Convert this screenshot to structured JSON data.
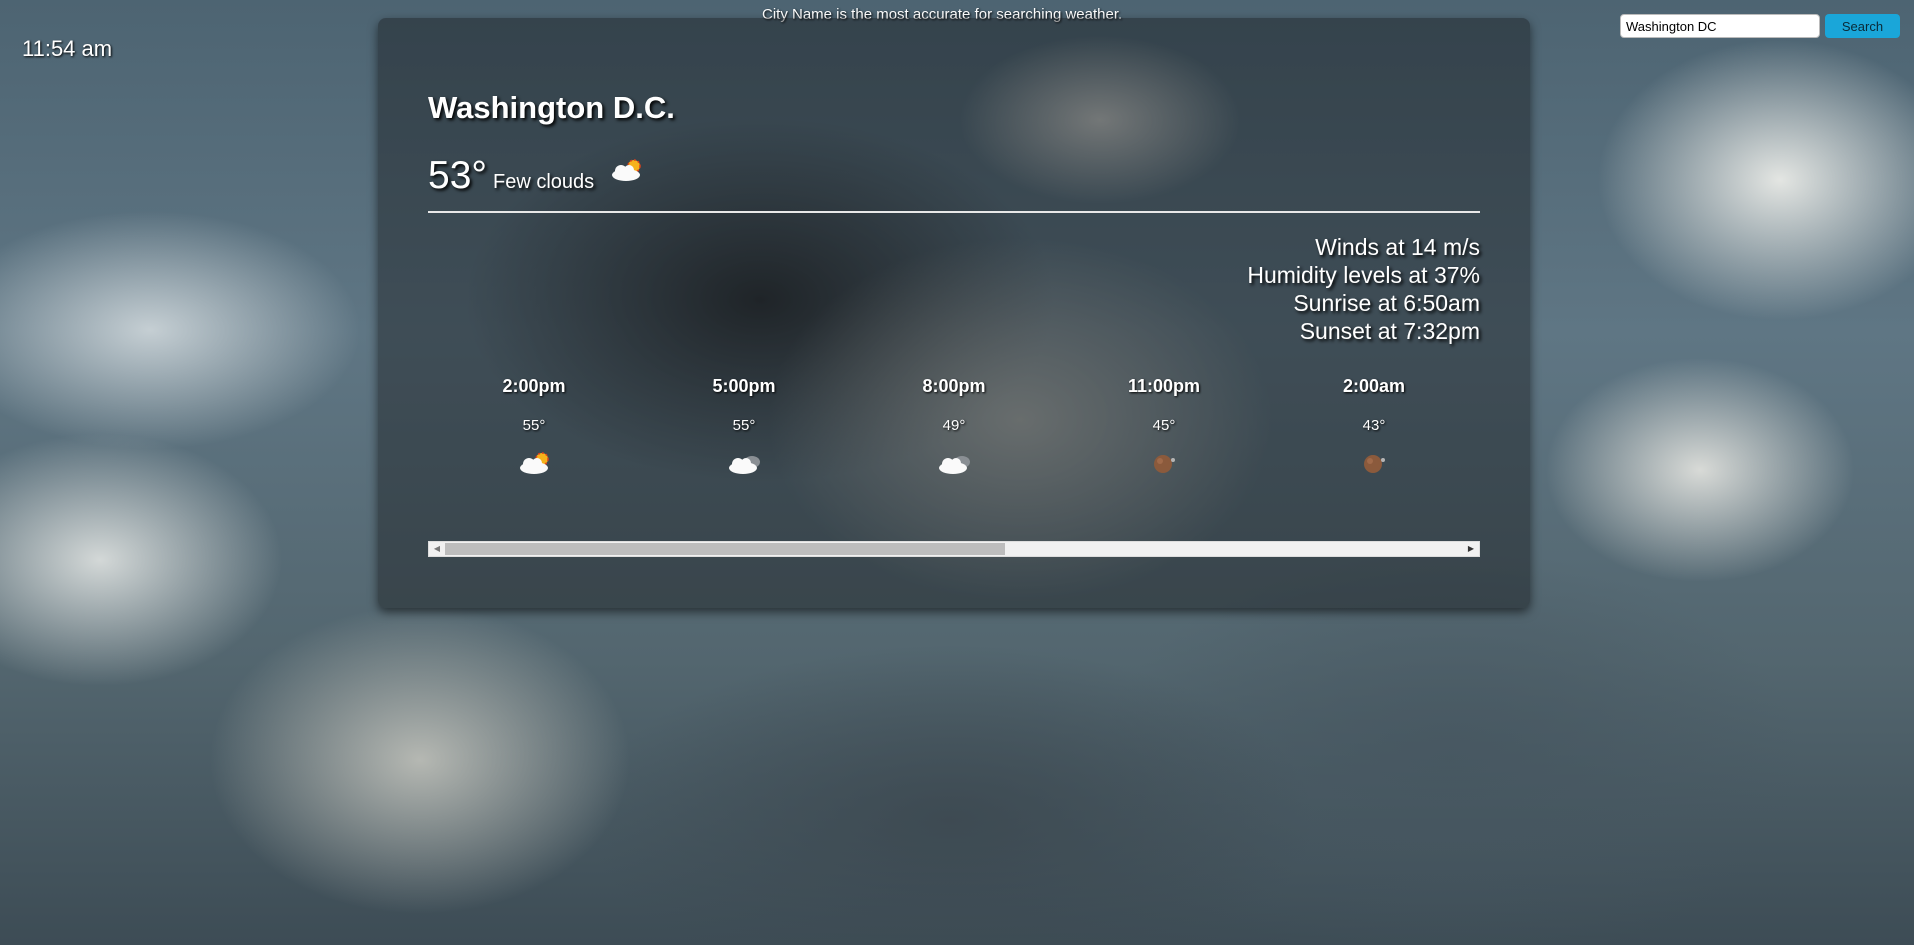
{
  "clock": "11:54 am",
  "hint": "City Name is the most accurate for searching weather.",
  "search": {
    "value": "Washington DC",
    "button_label": "Search"
  },
  "weather": {
    "city": "Washington D.C.",
    "temperature": "53°",
    "description": "Few clouds",
    "icon": "cloud-sun-icon",
    "details": {
      "winds": "Winds at 14 m/s",
      "humidity": "Humidity levels at 37%",
      "sunrise": "Sunrise at 6:50am",
      "sunset": "Sunset at 7:32pm"
    }
  },
  "forecast": [
    {
      "time": "2:00pm",
      "temp": "55°",
      "icon": "cloud-sun-icon"
    },
    {
      "time": "5:00pm",
      "temp": "55°",
      "icon": "cloud-icon"
    },
    {
      "time": "8:00pm",
      "temp": "49°",
      "icon": "cloud-icon"
    },
    {
      "time": "11:00pm",
      "temp": "45°",
      "icon": "moon-icon"
    },
    {
      "time": "2:00am",
      "temp": "43°",
      "icon": "moon-icon"
    }
  ],
  "scroll_position": 0.55
}
